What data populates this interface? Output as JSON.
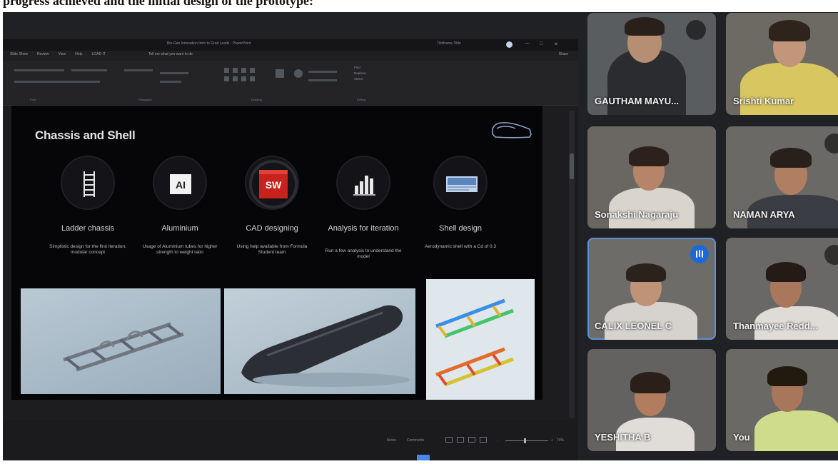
{
  "header_text": "progress achieved and the initial design of the prototype:",
  "powerpoint": {
    "doc_title": "Bio-Gen Innovation Intro to Grad Leads - PowerPoint",
    "account": "Tilothama Tilde",
    "menu": [
      "Slide Show",
      "Review",
      "View",
      "Help",
      "LOAD IT"
    ],
    "tell_me": "Tell me what you want to do",
    "share": "Share",
    "ribbon_groups": [
      "Font",
      "Paragraph",
      "Drawing",
      "Editing"
    ],
    "ribbon_editing": [
      "Find",
      "Replace",
      "Select"
    ],
    "status_notes": "Notes",
    "status_comments": "Comments",
    "zoom": "74%"
  },
  "slide": {
    "title": "Chassis and Shell",
    "features": [
      {
        "icon": "ladder-icon",
        "title": "Ladder chassis",
        "desc": "Simplistic design for the first iteration, modular concept"
      },
      {
        "icon": "aluminium-icon",
        "title": "Aluminium",
        "desc": "Usage of Aluminium tubes for higher strength to weight ratio"
      },
      {
        "icon": "solidworks-icon",
        "title": "CAD designing",
        "desc": "Using help available from Formula Student team"
      },
      {
        "icon": "bar-chart-icon",
        "title": "Analysis for iteration",
        "desc": "Run a few analysis to understand the model"
      },
      {
        "icon": "shell-icon",
        "title": "Shell design",
        "desc": "Aerodynamic shell with a Cd of 0.3"
      }
    ],
    "icon_text": {
      "ai": "AI",
      "sw": "SW"
    }
  },
  "participants": [
    {
      "name": "GAUTHAM MAYU...",
      "state": "muted"
    },
    {
      "name": "Srishti Kumar",
      "state": "normal"
    },
    {
      "name": "Sonakshi Nagaraju",
      "state": "normal"
    },
    {
      "name": "NAMAN ARYA",
      "state": "muted"
    },
    {
      "name": "CALIX LEONEL C",
      "state": "speaking"
    },
    {
      "name": "Thanmayee Redd...",
      "state": "muted"
    },
    {
      "name": "YESHITHA B",
      "state": "normal"
    },
    {
      "name": "You",
      "state": "normal"
    }
  ],
  "colors": {
    "background": "#202124",
    "accent": "#1f68d8"
  }
}
